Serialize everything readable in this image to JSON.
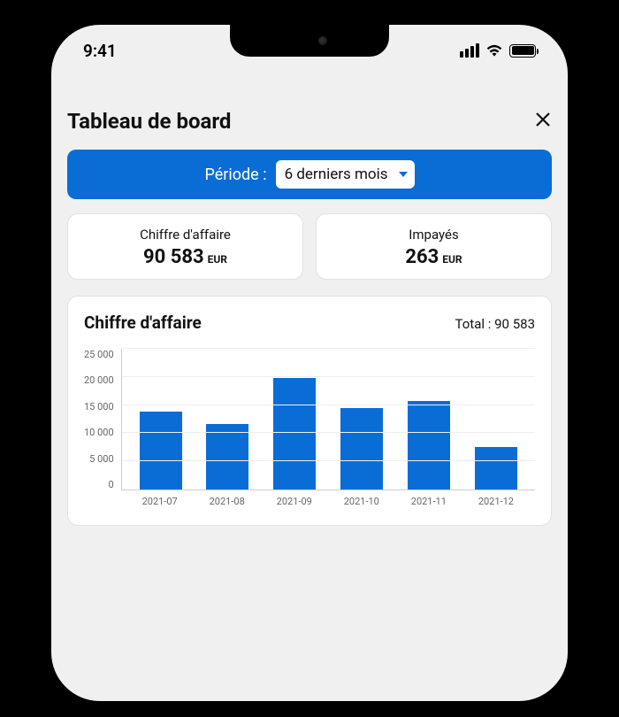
{
  "status": {
    "time": "9:41"
  },
  "header": {
    "title": "Tableau de board"
  },
  "period": {
    "label": "Période :",
    "selected": "6 derniers mois"
  },
  "kpis": [
    {
      "label": "Chiffre d'affaire",
      "value": "90 583",
      "unit": "EUR"
    },
    {
      "label": "Impayés",
      "value": "263",
      "unit": "EUR"
    }
  ],
  "chart": {
    "title": "Chiffre d'affaire",
    "total_label": "Total :",
    "total_value": "90 583"
  },
  "chart_data": {
    "type": "bar",
    "title": "Chiffre d'affaire",
    "categories": [
      "2021-07",
      "2021-08",
      "2021-09",
      "2021-10",
      "2021-11",
      "2021-12"
    ],
    "values": [
      13800,
      11600,
      19800,
      14400,
      15700,
      7600
    ],
    "y_ticks": [
      0,
      5000,
      10000,
      15000,
      20000,
      25000
    ],
    "y_tick_labels": [
      "0",
      "5 000",
      "10 000",
      "15 000",
      "20 000",
      "25 000"
    ],
    "ylim": [
      0,
      25000
    ],
    "xlabel": "",
    "ylabel": ""
  }
}
